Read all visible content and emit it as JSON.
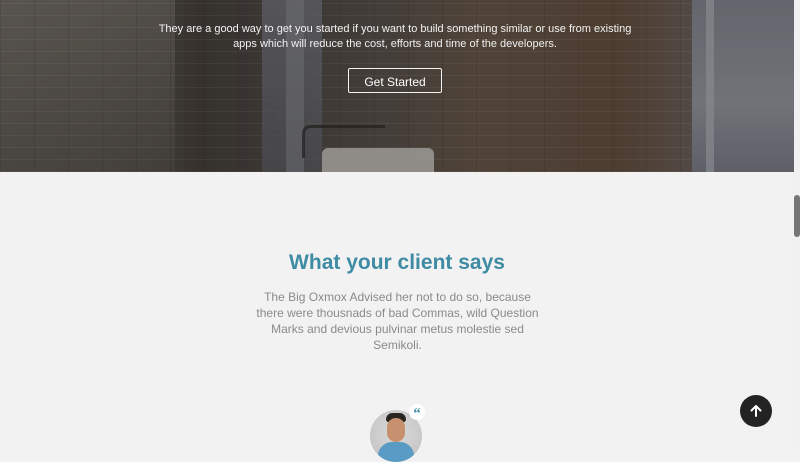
{
  "hero": {
    "description": "They are a good way to get you started if you want to build something similar or use from existing apps which will reduce the cost, efforts and time of the developers.",
    "cta_label": "Get Started"
  },
  "testimonials": {
    "title": "What your client says",
    "description": "The Big Oxmox Advised her not to do so, because there were thousnads of bad Commas, wild Question Marks and devious pulvinar metus molestie sed Semikoli.",
    "quote_glyph": "“"
  },
  "icons": {
    "scroll_top": "arrow-up-icon",
    "quote": "quote-icon"
  },
  "colors": {
    "accent": "#3e8ba4",
    "section_background": "#f3f2f3",
    "fab_background": "#232323"
  }
}
